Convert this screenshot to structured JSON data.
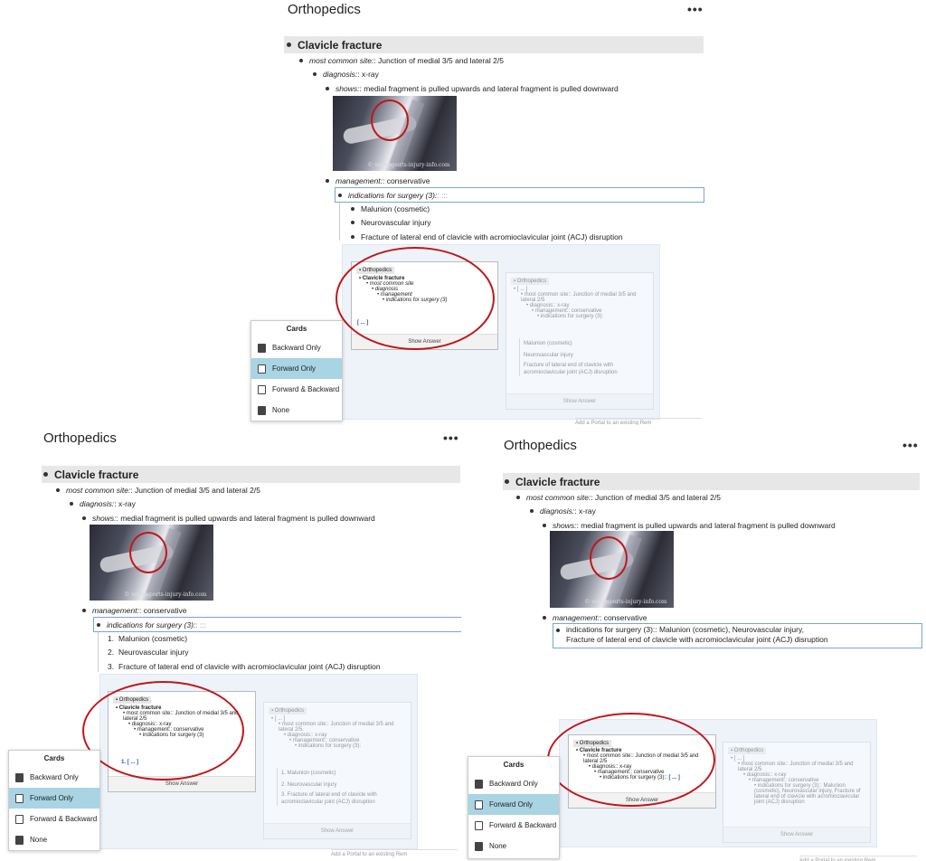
{
  "doc": {
    "title": "Orthopedics",
    "more": "•••",
    "heading": "Clavicle fracture",
    "site_key": "most common site:",
    "site_val": ": Junction of medial 3/5 and lateral 2/5",
    "diag_key": "diagnosis:",
    "diag_val": ": x-ray",
    "shows_key": "shows:",
    "shows_val": ": medial fragment is pulled upwards and lateral fragment is pulled downward",
    "xray_watermark": "© www.sports-injury-info.com",
    "mgmt_key": "management:",
    "mgmt_val": ": conservative",
    "surgery_key": "indications for surgery (3):",
    "surgery_sep1": ":  :::",
    "surgery_sep2": ": :::",
    "surgery_inline": "indications for surgery (3):: Malunion (cosmetic), Neurovascular injury,",
    "surgery_inline2": "Fracture of lateral end of clavicle with acromioclavicular joint (ACJ) disruption",
    "items": [
      "Malunion (cosmetic)",
      "Neurovascular injury",
      "Fracture of lateral end of clavicle with acromioclavicular joint (ACJ) disruption"
    ],
    "nums": [
      "1.",
      "2.",
      "3."
    ]
  },
  "card": {
    "crumb": "Orthopedics",
    "heading": "Clavicle fracture",
    "site": "most common site",
    "site_full": "most common site:: Junction of medial 3/5 and lateral 2/5",
    "diagnosis": "diagnosis",
    "diagnosis_full": "diagnosis:: x-ray",
    "management": "management",
    "management_full": "management:: conservative",
    "surgery": "indications for surgery (3)",
    "surgery_full": "indications for surgery (3):",
    "surgery_inline": "indications for surgery (3)::",
    "blank": "[ ... ]",
    "list_blank": "1. [ ... ]",
    "show_answer": "Show Answer",
    "faded_items": [
      "Malunion (cosmetic)",
      "Neurovascular injury",
      "Fracture of lateral end of clavicle with acromioclavicular joint (ACJ) disruption"
    ],
    "faded_numbered": [
      "1. Malunion (cosmetic)",
      "2. Neurovascular injury",
      "3. Fracture of lateral end of clavicle with acromioclavicular joint (ACJ) disruption"
    ],
    "faded_answer": "indications for surgery (3):: Malunion (cosmetic), Neurovascular injury, Fracture of lateral end of clavicle with acromioclavicular joint (ACJ) disruption"
  },
  "menu": {
    "title": "Cards",
    "items": [
      "Backward Only",
      "Forward Only",
      "Forward & Backward",
      "None"
    ]
  },
  "portal_placeholder": "Add a Portal to an existing Rem",
  "colors": {
    "annotation": "#c0161b",
    "selected": "#a8d4e3",
    "heading_bg": "#e7e7e7"
  }
}
